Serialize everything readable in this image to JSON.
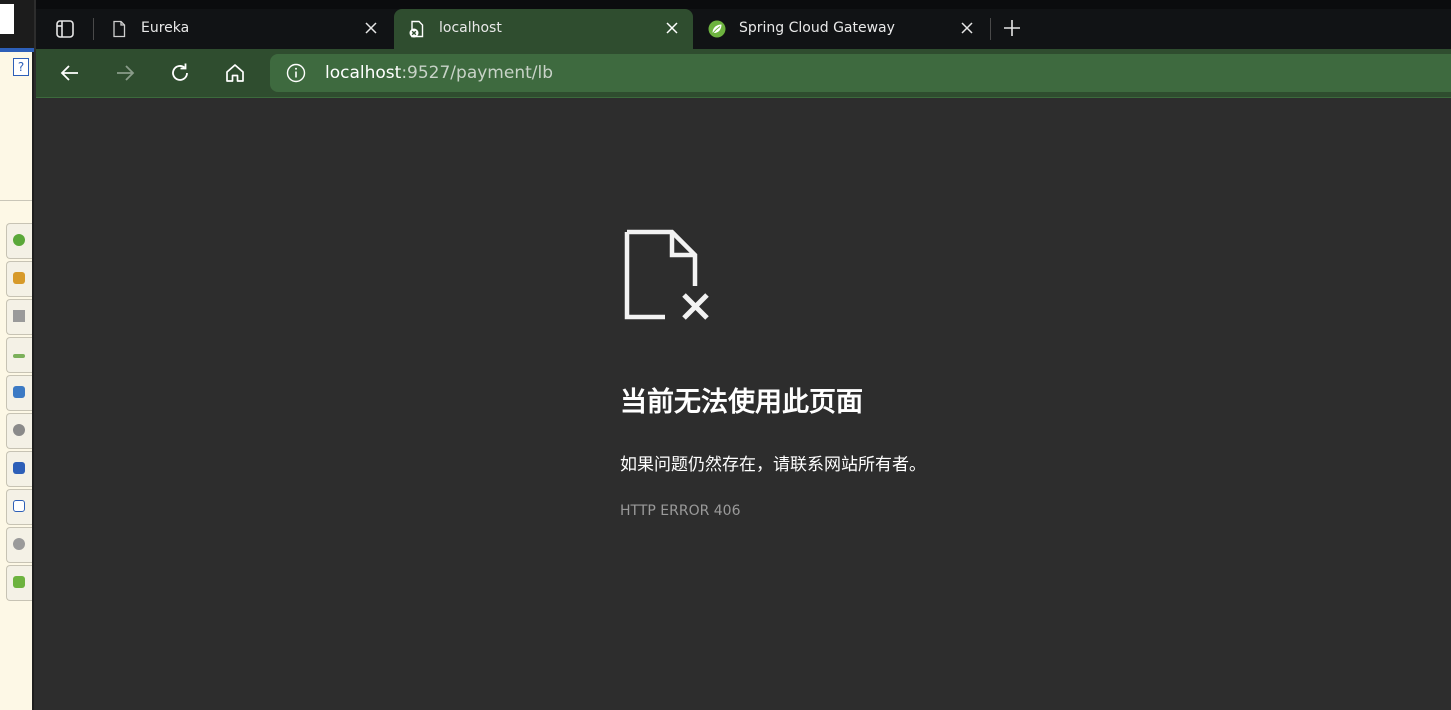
{
  "browser": {
    "tabs": [
      {
        "title": "Eureka",
        "icon": "page-icon",
        "active": false
      },
      {
        "title": "localhost",
        "icon": "broken-page-icon",
        "active": true
      },
      {
        "title": "Spring Cloud Gateway",
        "icon": "spring-leaf-icon",
        "active": false
      }
    ],
    "address": {
      "host": "localhost",
      "path": ":9527/payment/lb"
    },
    "colors": {
      "frame": "#2f4d2f",
      "address_bar": "#3e6a3f",
      "page_background": "#2d2d2d",
      "spring_green": "#6db33f"
    }
  },
  "error_page": {
    "icon": "file-error-icon",
    "title": "当前无法使用此页面",
    "description": "如果问题仍然存在，请联系网站所有者。",
    "code": "HTTP ERROR 406"
  },
  "background_app": {
    "help_label": "?"
  }
}
